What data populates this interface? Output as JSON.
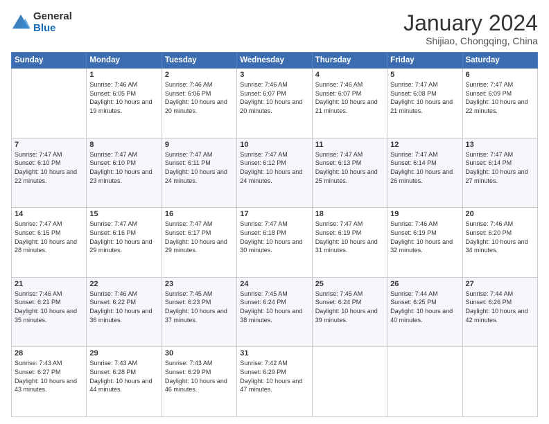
{
  "logo": {
    "general": "General",
    "blue": "Blue"
  },
  "header": {
    "title": "January 2024",
    "subtitle": "Shijiao, Chongqing, China"
  },
  "days_of_week": [
    "Sunday",
    "Monday",
    "Tuesday",
    "Wednesday",
    "Thursday",
    "Friday",
    "Saturday"
  ],
  "weeks": [
    [
      {
        "day": "",
        "sunrise": "",
        "sunset": "",
        "daylight": ""
      },
      {
        "day": "1",
        "sunrise": "Sunrise: 7:46 AM",
        "sunset": "Sunset: 6:05 PM",
        "daylight": "Daylight: 10 hours and 19 minutes."
      },
      {
        "day": "2",
        "sunrise": "Sunrise: 7:46 AM",
        "sunset": "Sunset: 6:06 PM",
        "daylight": "Daylight: 10 hours and 20 minutes."
      },
      {
        "day": "3",
        "sunrise": "Sunrise: 7:46 AM",
        "sunset": "Sunset: 6:07 PM",
        "daylight": "Daylight: 10 hours and 20 minutes."
      },
      {
        "day": "4",
        "sunrise": "Sunrise: 7:46 AM",
        "sunset": "Sunset: 6:07 PM",
        "daylight": "Daylight: 10 hours and 21 minutes."
      },
      {
        "day": "5",
        "sunrise": "Sunrise: 7:47 AM",
        "sunset": "Sunset: 6:08 PM",
        "daylight": "Daylight: 10 hours and 21 minutes."
      },
      {
        "day": "6",
        "sunrise": "Sunrise: 7:47 AM",
        "sunset": "Sunset: 6:09 PM",
        "daylight": "Daylight: 10 hours and 22 minutes."
      }
    ],
    [
      {
        "day": "7",
        "sunrise": "Sunrise: 7:47 AM",
        "sunset": "Sunset: 6:10 PM",
        "daylight": "Daylight: 10 hours and 22 minutes."
      },
      {
        "day": "8",
        "sunrise": "Sunrise: 7:47 AM",
        "sunset": "Sunset: 6:10 PM",
        "daylight": "Daylight: 10 hours and 23 minutes."
      },
      {
        "day": "9",
        "sunrise": "Sunrise: 7:47 AM",
        "sunset": "Sunset: 6:11 PM",
        "daylight": "Daylight: 10 hours and 24 minutes."
      },
      {
        "day": "10",
        "sunrise": "Sunrise: 7:47 AM",
        "sunset": "Sunset: 6:12 PM",
        "daylight": "Daylight: 10 hours and 24 minutes."
      },
      {
        "day": "11",
        "sunrise": "Sunrise: 7:47 AM",
        "sunset": "Sunset: 6:13 PM",
        "daylight": "Daylight: 10 hours and 25 minutes."
      },
      {
        "day": "12",
        "sunrise": "Sunrise: 7:47 AM",
        "sunset": "Sunset: 6:14 PM",
        "daylight": "Daylight: 10 hours and 26 minutes."
      },
      {
        "day": "13",
        "sunrise": "Sunrise: 7:47 AM",
        "sunset": "Sunset: 6:14 PM",
        "daylight": "Daylight: 10 hours and 27 minutes."
      }
    ],
    [
      {
        "day": "14",
        "sunrise": "Sunrise: 7:47 AM",
        "sunset": "Sunset: 6:15 PM",
        "daylight": "Daylight: 10 hours and 28 minutes."
      },
      {
        "day": "15",
        "sunrise": "Sunrise: 7:47 AM",
        "sunset": "Sunset: 6:16 PM",
        "daylight": "Daylight: 10 hours and 29 minutes."
      },
      {
        "day": "16",
        "sunrise": "Sunrise: 7:47 AM",
        "sunset": "Sunset: 6:17 PM",
        "daylight": "Daylight: 10 hours and 29 minutes."
      },
      {
        "day": "17",
        "sunrise": "Sunrise: 7:47 AM",
        "sunset": "Sunset: 6:18 PM",
        "daylight": "Daylight: 10 hours and 30 minutes."
      },
      {
        "day": "18",
        "sunrise": "Sunrise: 7:47 AM",
        "sunset": "Sunset: 6:19 PM",
        "daylight": "Daylight: 10 hours and 31 minutes."
      },
      {
        "day": "19",
        "sunrise": "Sunrise: 7:46 AM",
        "sunset": "Sunset: 6:19 PM",
        "daylight": "Daylight: 10 hours and 32 minutes."
      },
      {
        "day": "20",
        "sunrise": "Sunrise: 7:46 AM",
        "sunset": "Sunset: 6:20 PM",
        "daylight": "Daylight: 10 hours and 34 minutes."
      }
    ],
    [
      {
        "day": "21",
        "sunrise": "Sunrise: 7:46 AM",
        "sunset": "Sunset: 6:21 PM",
        "daylight": "Daylight: 10 hours and 35 minutes."
      },
      {
        "day": "22",
        "sunrise": "Sunrise: 7:46 AM",
        "sunset": "Sunset: 6:22 PM",
        "daylight": "Daylight: 10 hours and 36 minutes."
      },
      {
        "day": "23",
        "sunrise": "Sunrise: 7:45 AM",
        "sunset": "Sunset: 6:23 PM",
        "daylight": "Daylight: 10 hours and 37 minutes."
      },
      {
        "day": "24",
        "sunrise": "Sunrise: 7:45 AM",
        "sunset": "Sunset: 6:24 PM",
        "daylight": "Daylight: 10 hours and 38 minutes."
      },
      {
        "day": "25",
        "sunrise": "Sunrise: 7:45 AM",
        "sunset": "Sunset: 6:24 PM",
        "daylight": "Daylight: 10 hours and 39 minutes."
      },
      {
        "day": "26",
        "sunrise": "Sunrise: 7:44 AM",
        "sunset": "Sunset: 6:25 PM",
        "daylight": "Daylight: 10 hours and 40 minutes."
      },
      {
        "day": "27",
        "sunrise": "Sunrise: 7:44 AM",
        "sunset": "Sunset: 6:26 PM",
        "daylight": "Daylight: 10 hours and 42 minutes."
      }
    ],
    [
      {
        "day": "28",
        "sunrise": "Sunrise: 7:43 AM",
        "sunset": "Sunset: 6:27 PM",
        "daylight": "Daylight: 10 hours and 43 minutes."
      },
      {
        "day": "29",
        "sunrise": "Sunrise: 7:43 AM",
        "sunset": "Sunset: 6:28 PM",
        "daylight": "Daylight: 10 hours and 44 minutes."
      },
      {
        "day": "30",
        "sunrise": "Sunrise: 7:43 AM",
        "sunset": "Sunset: 6:29 PM",
        "daylight": "Daylight: 10 hours and 46 minutes."
      },
      {
        "day": "31",
        "sunrise": "Sunrise: 7:42 AM",
        "sunset": "Sunset: 6:29 PM",
        "daylight": "Daylight: 10 hours and 47 minutes."
      },
      {
        "day": "",
        "sunrise": "",
        "sunset": "",
        "daylight": ""
      },
      {
        "day": "",
        "sunrise": "",
        "sunset": "",
        "daylight": ""
      },
      {
        "day": "",
        "sunrise": "",
        "sunset": "",
        "daylight": ""
      }
    ]
  ]
}
